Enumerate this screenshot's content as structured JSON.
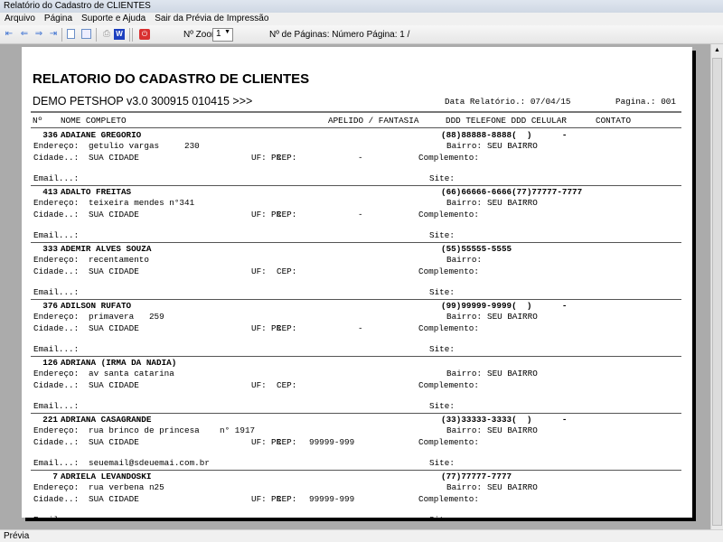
{
  "window": {
    "title": "Relatório do Cadastro de CLIENTES"
  },
  "menu": [
    "Arquivo",
    "Página",
    "Suporte e Ajuda",
    "Sair da Prévia de Impressão"
  ],
  "toolbar": {
    "zoom_label": "Nº Zoom",
    "zoom_value": "1",
    "pages_label": "Nº de Páginas: Número Página: 1 /"
  },
  "status": "Prévia",
  "report": {
    "title": "RELATORIO DO CADASTRO DE CLIENTES",
    "subtitle": "DEMO PETSHOP v3.0 300915 010415 >>>",
    "date": "Data Relatório.: 07/04/15",
    "page": "Pagina.: 001",
    "headers": {
      "num": "Nº",
      "name": "NOME COMPLETO",
      "alias": "APELIDO / FANTASIA",
      "phones": "DDD TELEFONE DDD CELULAR",
      "contact": "CONTATO"
    },
    "labels": {
      "address": "Endereço:",
      "district": "Bairro:",
      "city": "Cidade..:",
      "uf": "UF:",
      "cep": "CEP:",
      "complement": "Complemento:",
      "email": "Email...:",
      "site": "Site:"
    },
    "records": [
      {
        "id": "336",
        "name": "ADAIANE GREGORIO",
        "phone": "(88)88888-8888(  )      -",
        "address": "getulio vargas     230",
        "district": "SEU BAIRRO",
        "city": "SUA CIDADE",
        "uf": "PR",
        "cep": "-",
        "email": ""
      },
      {
        "id": "413",
        "name": "ADALTO FREITAS",
        "phone": "(66)66666-6666(77)77777-7777",
        "address": "teixeira mendes n°341",
        "district": "SEU BAIRRO",
        "city": "SUA CIDADE",
        "uf": "PR",
        "cep": "-",
        "email": ""
      },
      {
        "id": "333",
        "name": "ADEMIR ALVES SOUZA",
        "phone": "(55)55555-5555",
        "address": "recentamento",
        "district": "",
        "city": "SUA CIDADE",
        "uf": "",
        "cep": "",
        "email": ""
      },
      {
        "id": "376",
        "name": "ADILSON RUFATO",
        "phone": "(99)99999-9999(  )      -",
        "address": "primavera   259",
        "district": "SEU BAIRRO",
        "city": "SUA CIDADE",
        "uf": "PR",
        "cep": "-",
        "email": ""
      },
      {
        "id": "126",
        "name": "ADRIANA (IRMA DA NADIA)",
        "phone": "",
        "address": "av santa catarina",
        "district": "SEU BAIRRO",
        "city": "SUA CIDADE",
        "uf": "",
        "cep": "",
        "email": ""
      },
      {
        "id": "221",
        "name": "ADRIANA CASAGRANDE",
        "phone": "(33)33333-3333(  )      -",
        "address": "rua brinco de princesa    n° 1917",
        "district": "SEU BAIRRO",
        "city": "SUA CIDADE",
        "uf": "PR",
        "cep": "99999-999",
        "email": "seuemail@sdeuemai.com.br"
      },
      {
        "id": "7",
        "name": "ADRIELA LEVANDOSKI",
        "phone": "(77)77777-7777",
        "address": "rua verbena n25",
        "district": "SEU BAIRRO",
        "city": "SUA CIDADE",
        "uf": "PR",
        "cep": "99999-999",
        "email": ""
      }
    ]
  }
}
